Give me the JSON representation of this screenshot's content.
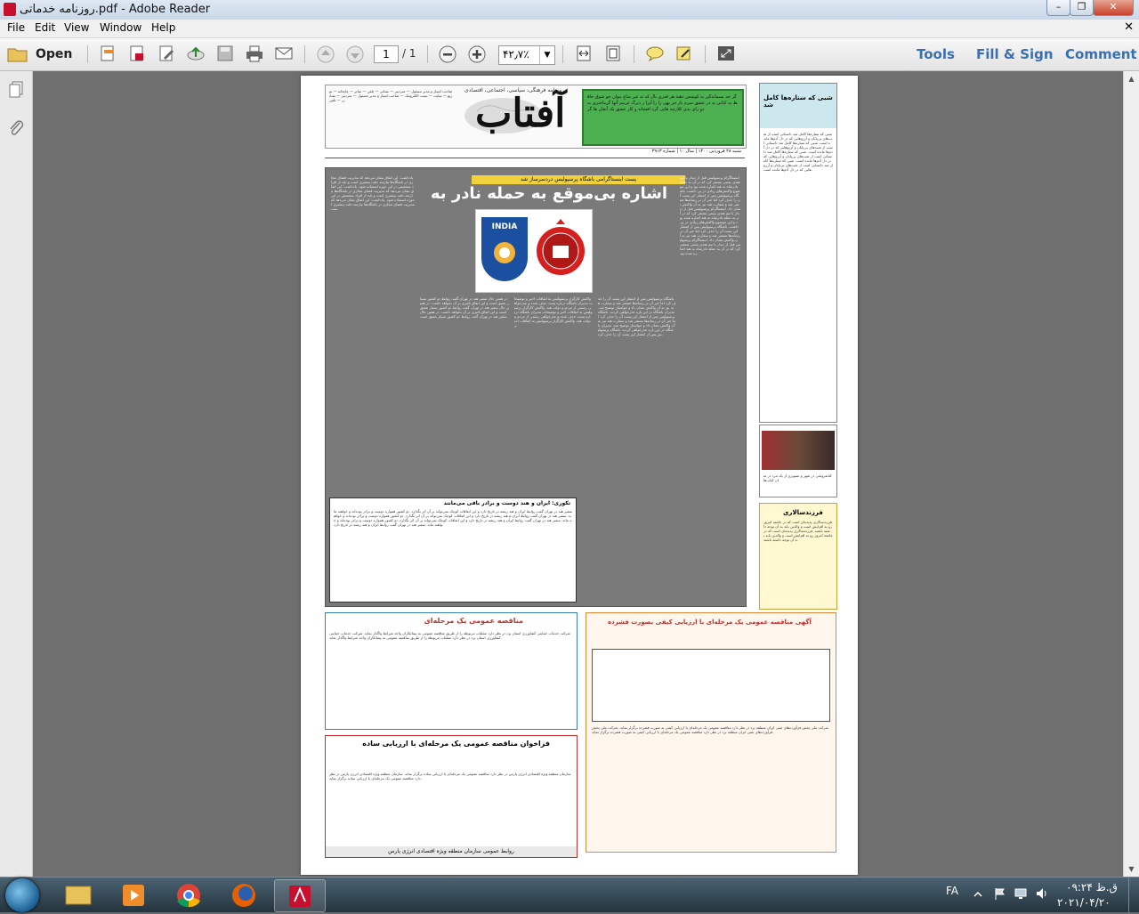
{
  "window": {
    "title": "روزنامه خدماتی.pdf - Adobe Reader",
    "min": "–",
    "max": "❐",
    "close": "✕"
  },
  "menu": [
    "File",
    "Edit",
    "View",
    "Window",
    "Help"
  ],
  "toolbar": {
    "open_label": "Open",
    "page_current": "1",
    "page_total": "/ 1",
    "zoom": "۴۲٫۷٪",
    "tools": "Tools",
    "fill_sign": "Fill & Sign",
    "comment": "Comment"
  },
  "newspaper": {
    "masthead": "آفتاب",
    "masthead_tag": "روزنامه فرهنگی، سیاسی، اجتماعی، اقتصادی",
    "date_line": "شنبه ۲۸ فروردین ۱۴۰۰ | سال ۱۰ | شماره ۳۹۱۳",
    "kicker": "پست اینستاگرامی باشگاه پرسپولیس دردسرساز شد",
    "headline": "اشاره بی‌موقع به حمله نادر به هند",
    "logo_left_text": "INDIA",
    "box_title": "تکوری: ایران و هند دوست و برادر باقی می‌مانند",
    "ad1_title": "مناقصه عمومی یک مرحله‌ای",
    "ad2_title": "آگهی مناقصه عمومی یک مرحله‌ای با ارزیابی کیفی بصورت فشرده",
    "ad3_title": "فراخوان مناقصه عمومی یک مرحله‌ای با ارزیابی ساده",
    "ad3_footer": "روابط عمومی سازمان منطقه ویژه اقتصادی انرژی پارس",
    "side_title": "شبی که ستاره‌ها کامل شد",
    "side_box_title": "فرزندسالاری"
  },
  "taskbar": {
    "lang": "FA",
    "time": "ق.ظ ۰۹:۲۴",
    "date": "۲۰۲۱/۰۴/۲۰"
  }
}
